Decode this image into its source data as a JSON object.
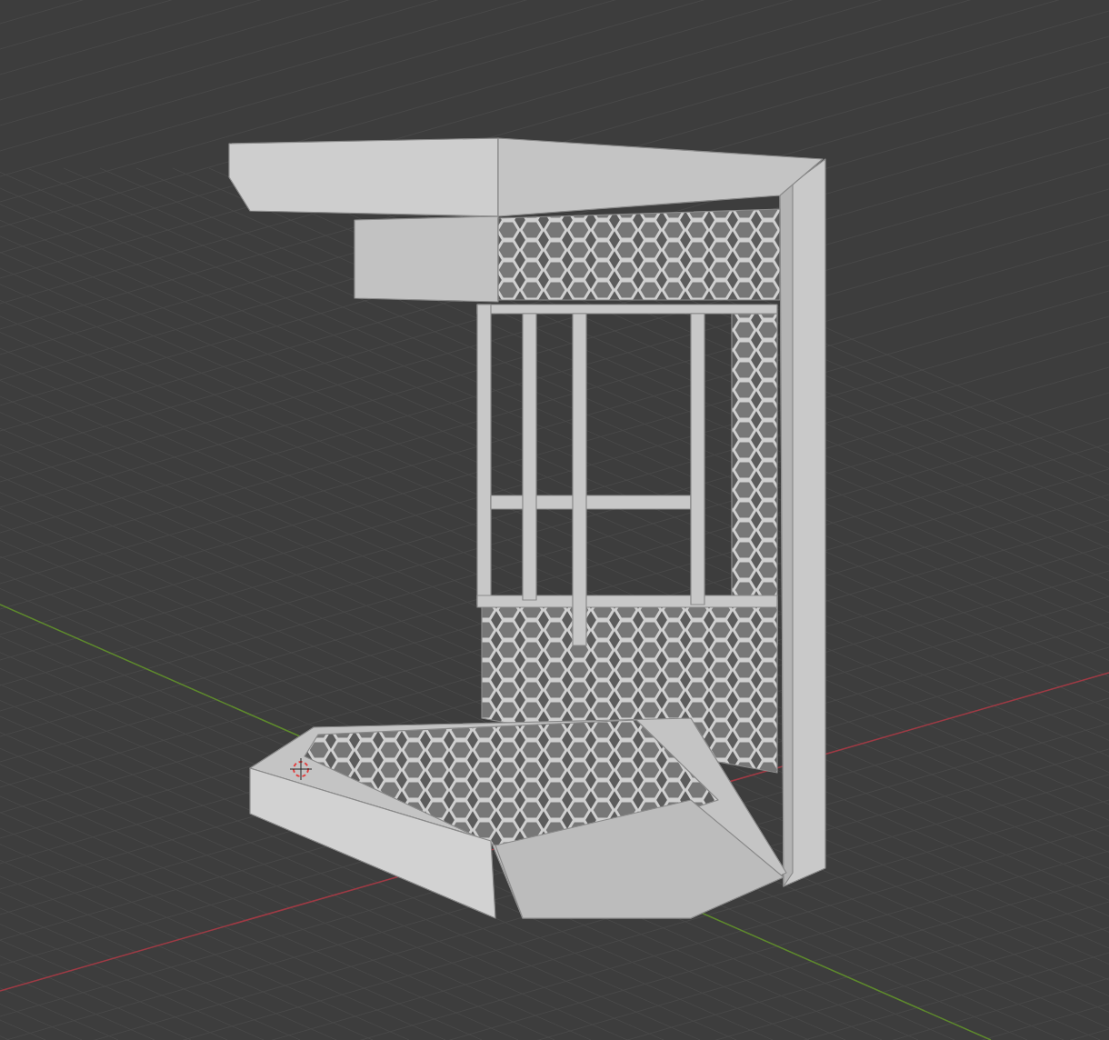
{
  "viewport": {
    "show_grid": true,
    "show_axes": true,
    "show_3d_cursor": true
  }
}
